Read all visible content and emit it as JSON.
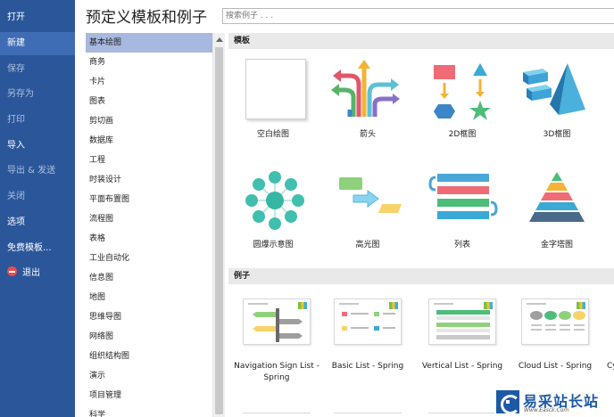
{
  "left_menu": {
    "items": [
      {
        "label": "打开",
        "state": "normal"
      },
      {
        "label": "新建",
        "state": "active"
      },
      {
        "label": "保存",
        "state": "dim"
      },
      {
        "label": "另存为",
        "state": "dim"
      },
      {
        "label": "打印",
        "state": "dim"
      },
      {
        "label": "导入",
        "state": "normal"
      },
      {
        "label": "导出 & 发送",
        "state": "dim"
      },
      {
        "label": "关闭",
        "state": "dim"
      },
      {
        "label": "选项",
        "state": "normal"
      },
      {
        "label": "免费模板...",
        "state": "normal"
      },
      {
        "label": "退出",
        "state": "normal",
        "icon": "exit-icon"
      }
    ]
  },
  "header": {
    "title": "预定义模板和例子",
    "search_placeholder": "搜索例子 . . ."
  },
  "categories": {
    "selected": "基本绘图",
    "items": [
      "基本绘图",
      "商务",
      "卡片",
      "图表",
      "剪切画",
      "数据库",
      "工程",
      "时装设计",
      "平面布置图",
      "流程图",
      "表格",
      "工业自动化",
      "信息图",
      "地图",
      "思维导图",
      "网络图",
      "组织结构图",
      "演示",
      "项目管理",
      "科学"
    ]
  },
  "templates_section": {
    "heading": "模板",
    "tiles": [
      {
        "label": "空白绘图",
        "icon": "blank-page-icon"
      },
      {
        "label": "箭头",
        "icon": "arrows-icon"
      },
      {
        "label": "2D框图",
        "icon": "2d-block-icon"
      },
      {
        "label": "3D框图",
        "icon": "3d-block-icon"
      },
      {
        "label": "圆爆示意图",
        "icon": "circle-spoke-icon"
      },
      {
        "label": "高光图",
        "icon": "highlight-icon"
      },
      {
        "label": "列表",
        "icon": "list-icon"
      },
      {
        "label": "金字塔图",
        "icon": "pyramid-icon"
      }
    ]
  },
  "examples_section": {
    "heading": "例子",
    "tiles": [
      {
        "label": "Navigation Sign List - Spring"
      },
      {
        "label": "Basic List - Spring"
      },
      {
        "label": "Vertical List - Spring"
      },
      {
        "label": "Cloud List - Spring"
      },
      {
        "label": "Cy"
      }
    ]
  },
  "watermark": {
    "name": "易采站长站",
    "url": "Www.Easck.Com"
  },
  "colors": {
    "menu_bg": "#2b579a",
    "menu_active": "#3f6db5",
    "category_selected": "#a8b9e0",
    "section_header": "#e9e9e9"
  }
}
